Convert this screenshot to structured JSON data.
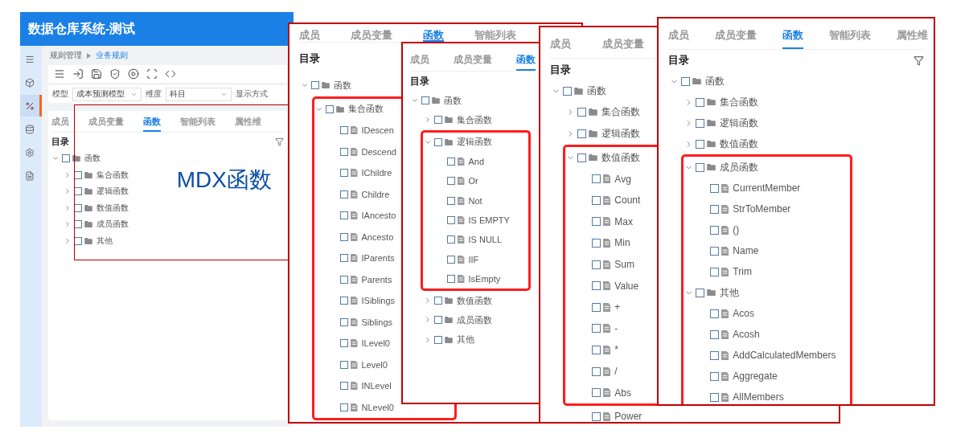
{
  "app": {
    "title": "数据仓库系统-测试",
    "sidebar": [
      {
        "kind": "menu",
        "selected": false
      },
      {
        "kind": "cube",
        "selected": false
      },
      {
        "kind": "formula",
        "selected": true
      },
      {
        "kind": "database",
        "selected": false
      },
      {
        "kind": "settings",
        "selected": false
      },
      {
        "kind": "report",
        "selected": false
      }
    ],
    "breadcrumb": [
      "规则管理",
      "业务规则"
    ],
    "toolbar": [
      {
        "kind": "menu"
      },
      {
        "kind": "import"
      },
      {
        "kind": "save"
      },
      {
        "kind": "shield"
      },
      {
        "kind": "run"
      },
      {
        "kind": "scan"
      },
      {
        "kind": "code"
      }
    ],
    "filters": [
      {
        "label": "模型",
        "value": "成本预测模型"
      },
      {
        "label": "维度",
        "value": "科目"
      },
      {
        "label": "显示方式"
      }
    ],
    "panel": {
      "tabs": [
        {
          "label": "成员",
          "selected": false
        },
        {
          "label": "成员变量",
          "selected": false
        },
        {
          "label": "函数",
          "selected": true
        },
        {
          "label": "智能列表",
          "selected": false
        },
        {
          "label": "属性维",
          "selected": false
        }
      ],
      "heading": "目录",
      "filter": true,
      "tree": [
        {
          "label": "函数",
          "kind": "folder",
          "expanded": true,
          "checked": false,
          "children": [
            {
              "label": "集合函数",
              "kind": "folder",
              "expanded": false,
              "checked": false
            },
            {
              "label": "逻辑函数",
              "kind": "folder",
              "expanded": false,
              "checked": false
            },
            {
              "label": "数值函数",
              "kind": "folder",
              "expanded": false,
              "checked": false
            },
            {
              "label": "成员函数",
              "kind": "folder",
              "expanded": false,
              "checked": false
            },
            {
              "label": "其他",
              "kind": "folder",
              "expanded": false,
              "checked": false
            }
          ]
        }
      ]
    }
  },
  "annotation": {
    "text": "MDX函数"
  },
  "panels": [
    {
      "tabs": [
        {
          "label": "成员",
          "selected": false
        },
        {
          "label": "成员变量",
          "selected": false
        },
        {
          "label": "函数",
          "selected": true
        },
        {
          "label": "智能列表",
          "selected": false
        }
      ],
      "heading": "目录",
      "tree": [
        {
          "label": "函数",
          "kind": "folder",
          "expanded": true,
          "checked": false,
          "highlighted": false,
          "children": [
            {
              "label": "集合函数",
              "kind": "folder",
              "expanded": true,
              "checked": false,
              "highlighted": true,
              "children": [
                {
                  "label": "IDescen",
                  "kind": "function",
                  "checked": false,
                  "highlighted": true
                },
                {
                  "label": "Descend",
                  "kind": "function",
                  "checked": false,
                  "highlighted": true
                },
                {
                  "label": "IChildre",
                  "kind": "function",
                  "checked": false,
                  "highlighted": true
                },
                {
                  "label": "Childre",
                  "kind": "function",
                  "checked": false,
                  "highlighted": true
                },
                {
                  "label": "IAncesto",
                  "kind": "function",
                  "checked": false,
                  "highlighted": true
                },
                {
                  "label": "Ancesto",
                  "kind": "function",
                  "checked": false,
                  "highlighted": true
                },
                {
                  "label": "IParents",
                  "kind": "function",
                  "checked": false,
                  "highlighted": true
                },
                {
                  "label": "Parents",
                  "kind": "function",
                  "checked": false,
                  "highlighted": true
                },
                {
                  "label": "ISiblings",
                  "kind": "function",
                  "checked": false,
                  "highlighted": true
                },
                {
                  "label": "Siblings",
                  "kind": "function",
                  "checked": false,
                  "highlighted": true
                },
                {
                  "label": "ILevel0",
                  "kind": "function",
                  "checked": false,
                  "highlighted": true
                },
                {
                  "label": "Level0",
                  "kind": "function",
                  "checked": false,
                  "highlighted": true
                },
                {
                  "label": "INLevel",
                  "kind": "function",
                  "checked": false,
                  "highlighted": true
                },
                {
                  "label": "NLevel0",
                  "kind": "function",
                  "checked": false,
                  "highlighted": true
                }
              ]
            }
          ]
        }
      ]
    },
    {
      "tabs": [
        {
          "label": "成员",
          "selected": false
        },
        {
          "label": "成员变量",
          "selected": false
        },
        {
          "label": "函数",
          "selected": true
        }
      ],
      "heading": "目录",
      "tree": [
        {
          "label": "函数",
          "kind": "folder",
          "expanded": true,
          "checked": false,
          "highlighted": false,
          "children": [
            {
              "label": "集合函数",
              "kind": "folder",
              "expanded": false,
              "checked": false,
              "highlighted": false
            },
            {
              "label": "逻辑函数",
              "kind": "folder",
              "expanded": true,
              "checked": false,
              "highlighted": true,
              "children": [
                {
                  "label": "And",
                  "kind": "function",
                  "checked": false,
                  "highlighted": true
                },
                {
                  "label": "Or",
                  "kind": "function",
                  "checked": false,
                  "highlighted": true
                },
                {
                  "label": "Not",
                  "kind": "function",
                  "checked": false,
                  "highlighted": true
                },
                {
                  "label": "IS EMPTY",
                  "kind": "function",
                  "checked": false,
                  "highlighted": true
                },
                {
                  "label": "IS NULL",
                  "kind": "function",
                  "checked": false,
                  "highlighted": true
                },
                {
                  "label": "IIF",
                  "kind": "function",
                  "checked": false,
                  "highlighted": true
                },
                {
                  "label": "IsEmpty",
                  "kind": "function",
                  "checked": false,
                  "highlighted": true
                }
              ]
            },
            {
              "label": "数值函数",
              "kind": "folder",
              "expanded": false,
              "checked": false,
              "highlighted": false
            },
            {
              "label": "成员函数",
              "kind": "folder",
              "expanded": false,
              "checked": false,
              "highlighted": false
            },
            {
              "label": "其他",
              "kind": "folder",
              "expanded": false,
              "checked": false,
              "highlighted": false
            }
          ]
        }
      ]
    },
    {
      "tabs": [
        {
          "label": "成员",
          "selected": false
        },
        {
          "label": "成员变量",
          "selected": false
        }
      ],
      "heading": "目录",
      "tree": [
        {
          "label": "函数",
          "kind": "folder",
          "expanded": true,
          "checked": false,
          "highlighted": false,
          "children": [
            {
              "label": "集合函数",
              "kind": "folder",
              "expanded": false,
              "checked": false,
              "highlighted": false
            },
            {
              "label": "逻辑函数",
              "kind": "folder",
              "expanded": false,
              "checked": false,
              "highlighted": false
            },
            {
              "label": "数值函数",
              "kind": "folder",
              "expanded": true,
              "checked": false,
              "highlighted": true,
              "children": [
                {
                  "label": "Avg",
                  "kind": "function",
                  "checked": false,
                  "highlighted": true
                },
                {
                  "label": "Count",
                  "kind": "function",
                  "checked": false,
                  "highlighted": true
                },
                {
                  "label": "Max",
                  "kind": "function",
                  "checked": false,
                  "highlighted": true
                },
                {
                  "label": "Min",
                  "kind": "function",
                  "checked": false,
                  "highlighted": true
                },
                {
                  "label": "Sum",
                  "kind": "function",
                  "checked": false,
                  "highlighted": true
                },
                {
                  "label": "Value",
                  "kind": "function",
                  "checked": false,
                  "highlighted": true
                },
                {
                  "label": "+",
                  "kind": "function",
                  "checked": false,
                  "highlighted": true
                },
                {
                  "label": "-",
                  "kind": "function",
                  "checked": false,
                  "highlighted": true
                },
                {
                  "label": "*",
                  "kind": "function",
                  "checked": false,
                  "highlighted": true
                },
                {
                  "label": "/",
                  "kind": "function",
                  "checked": false,
                  "highlighted": true
                },
                {
                  "label": "Abs",
                  "kind": "function",
                  "checked": false,
                  "highlighted": true
                },
                {
                  "label": "Power",
                  "kind": "function",
                  "checked": false,
                  "highlighted": false
                }
              ]
            }
          ]
        }
      ]
    },
    {
      "tabs": [
        {
          "label": "成员",
          "selected": false
        },
        {
          "label": "成员变量",
          "selected": false
        },
        {
          "label": "函数",
          "selected": true
        },
        {
          "label": "智能列表",
          "selected": false
        },
        {
          "label": "属性维",
          "selected": false
        }
      ],
      "heading": "目录",
      "filter": true,
      "tree": [
        {
          "label": "函数",
          "kind": "folder",
          "expanded": true,
          "checked": false,
          "highlighted": false,
          "children": [
            {
              "label": "集合函数",
              "kind": "folder",
              "expanded": false,
              "checked": false,
              "highlighted": false
            },
            {
              "label": "逻辑函数",
              "kind": "folder",
              "expanded": false,
              "checked": false,
              "highlighted": false
            },
            {
              "label": "数值函数",
              "kind": "folder",
              "expanded": false,
              "checked": false,
              "highlighted": false
            },
            {
              "label": "成员函数",
              "kind": "folder",
              "expanded": true,
              "checked": false,
              "highlighted": true,
              "children": [
                {
                  "label": "CurrentMember",
                  "kind": "function",
                  "checked": false,
                  "highlighted": true
                },
                {
                  "label": "StrToMember",
                  "kind": "function",
                  "checked": false,
                  "highlighted": true
                },
                {
                  "label": "()",
                  "kind": "function",
                  "checked": false,
                  "highlighted": true
                },
                {
                  "label": "Name",
                  "kind": "function",
                  "checked": false,
                  "highlighted": true
                },
                {
                  "label": "Trim",
                  "kind": "function",
                  "checked": false,
                  "highlighted": true
                }
              ]
            },
            {
              "label": "其他",
              "kind": "folder",
              "expanded": true,
              "checked": false,
              "highlighted": true,
              "children": [
                {
                  "label": "Acos",
                  "kind": "function",
                  "checked": false,
                  "highlighted": true
                },
                {
                  "label": "Acosh",
                  "kind": "function",
                  "checked": false,
                  "highlighted": true
                },
                {
                  "label": "AddCalculatedMembers",
                  "kind": "function",
                  "checked": false,
                  "highlighted": true
                },
                {
                  "label": "Aggregate",
                  "kind": "function",
                  "checked": false,
                  "highlighted": true
                },
                {
                  "label": "AllMembers",
                  "kind": "function",
                  "checked": false,
                  "highlighted": true
                }
              ]
            }
          ]
        }
      ]
    }
  ]
}
